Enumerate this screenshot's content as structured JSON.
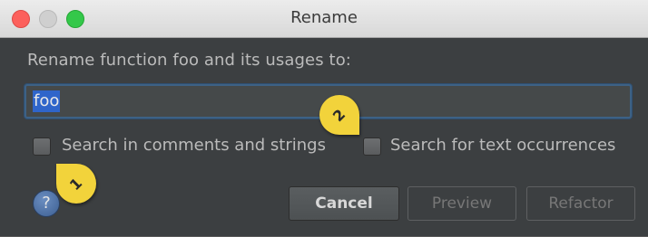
{
  "window": {
    "title": "Rename"
  },
  "dialog": {
    "prompt": "Rename function foo and its usages to:",
    "new_name": "foo"
  },
  "options": {
    "search_comments": {
      "label": "Search in comments and strings",
      "checked": false
    },
    "search_text": {
      "label": "Search for text occurrences",
      "checked": false
    }
  },
  "buttons": {
    "help": "?",
    "cancel": "Cancel",
    "preview": "Preview",
    "refactor": "Refactor"
  },
  "callouts": {
    "one": "1",
    "two": "2"
  },
  "colors": {
    "background": "#3c3f41",
    "selection": "#2f65ca",
    "callout": "#f2d33b"
  }
}
